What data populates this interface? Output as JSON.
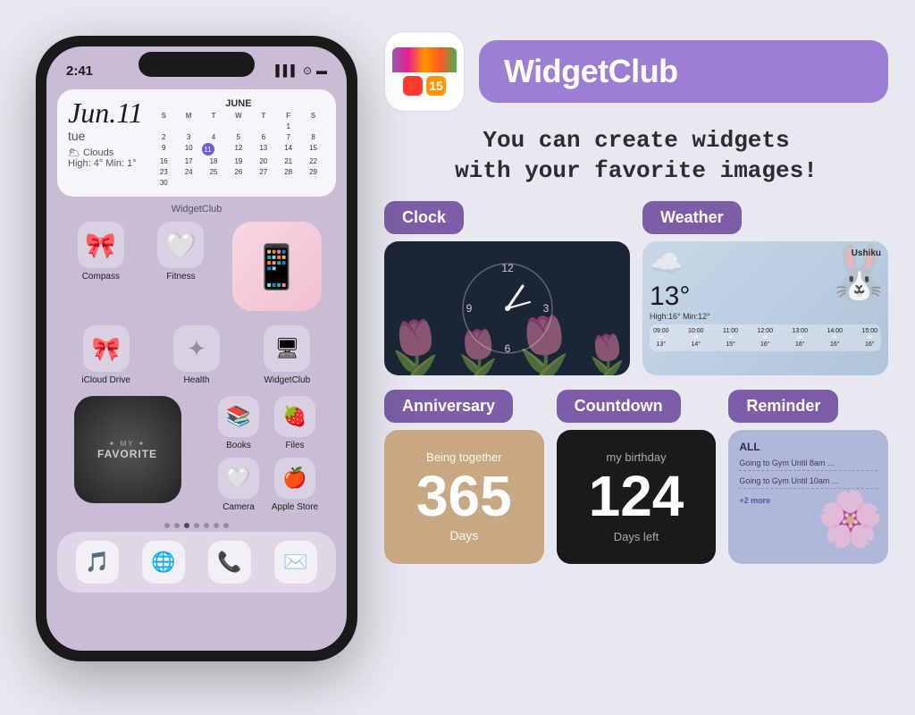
{
  "phone": {
    "status_time": "2:41",
    "screen_label": "WidgetClub",
    "calendar": {
      "date": "Jun.11",
      "day": "tue",
      "weather": "🌥 Clouds",
      "temp": "High: 4°  Min: 1°",
      "month": "JUNE",
      "headers": [
        "S",
        "M",
        "T",
        "W",
        "T",
        "F",
        "S"
      ],
      "rows": [
        [
          "",
          "",
          "",
          "1",
          "",
          "",
          ""
        ],
        [
          "2",
          "3",
          "4",
          "5",
          "6",
          "7",
          "8"
        ],
        [
          "9",
          "10",
          "11",
          "12",
          "13",
          "14",
          "15"
        ],
        [
          "16",
          "17",
          "18",
          "19",
          "20",
          "21",
          "22"
        ],
        [
          "23",
          "24",
          "25",
          "26",
          "27",
          "28",
          "29"
        ],
        [
          "30",
          "",
          "",
          "",
          "",
          "",
          ""
        ]
      ],
      "today": "11"
    },
    "apps_row1": [
      {
        "label": "Compass",
        "icon": "🧭"
      },
      {
        "label": "Fitness",
        "icon": "🤍"
      },
      {
        "label": "",
        "icon": ""
      }
    ],
    "apps_row2": [
      {
        "label": "iCloud Drive",
        "icon": "🎀"
      },
      {
        "label": "Health",
        "icon": "✦"
      },
      {
        "label": "WidgetClub",
        "icon": "📱"
      }
    ],
    "apps_row3": [
      {
        "label": "WidgetClub",
        "icon": "⭐"
      },
      {
        "label": "Books",
        "icon": "📚"
      },
      {
        "label": "Files",
        "icon": "🍓"
      }
    ],
    "apps_row4": [
      {
        "label": "Camera",
        "icon": "🤍"
      },
      {
        "label": "Apple Store",
        "icon": "🍎"
      }
    ],
    "dock_icons": [
      "🎵",
      "🌐",
      "📞",
      "✉️"
    ],
    "my_favorite": {
      "line1": "✦ MY ✦",
      "line2": "FAVORITE"
    }
  },
  "app": {
    "name": "WidgetClub",
    "tagline_line1": "You can create widgets",
    "tagline_line2": "with your favorite images!"
  },
  "widgets": {
    "clock": {
      "label": "Clock",
      "badge_color": "#7b5ea7"
    },
    "weather": {
      "label": "Weather",
      "badge_color": "#7b5ea7",
      "city": "Ushiku",
      "temp": "13°",
      "high": "High:16°",
      "min": "Min:12°",
      "hours": [
        "09:00",
        "10:00",
        "11:00",
        "12:00",
        "13:00",
        "14:00",
        "15:00"
      ],
      "hour_temps": [
        "13°",
        "14°",
        "15°",
        "16°",
        "16°",
        "16°",
        "16°"
      ]
    },
    "anniversary": {
      "label": "Anniversary",
      "badge_color": "#7b5ea7",
      "sub": "Being together",
      "num": "365",
      "unit": "Days"
    },
    "countdown": {
      "label": "Countdown",
      "badge_color": "#7b5ea7",
      "sub": "my birthday",
      "num": "124",
      "unit": "Days left"
    },
    "reminder": {
      "label": "Reminder",
      "badge_color": "#7b5ea7",
      "title": "ALL",
      "items": [
        "Going to Gym Until 8am ...",
        "Going to Gym Until 10am ..."
      ],
      "more": "+2 more"
    }
  }
}
